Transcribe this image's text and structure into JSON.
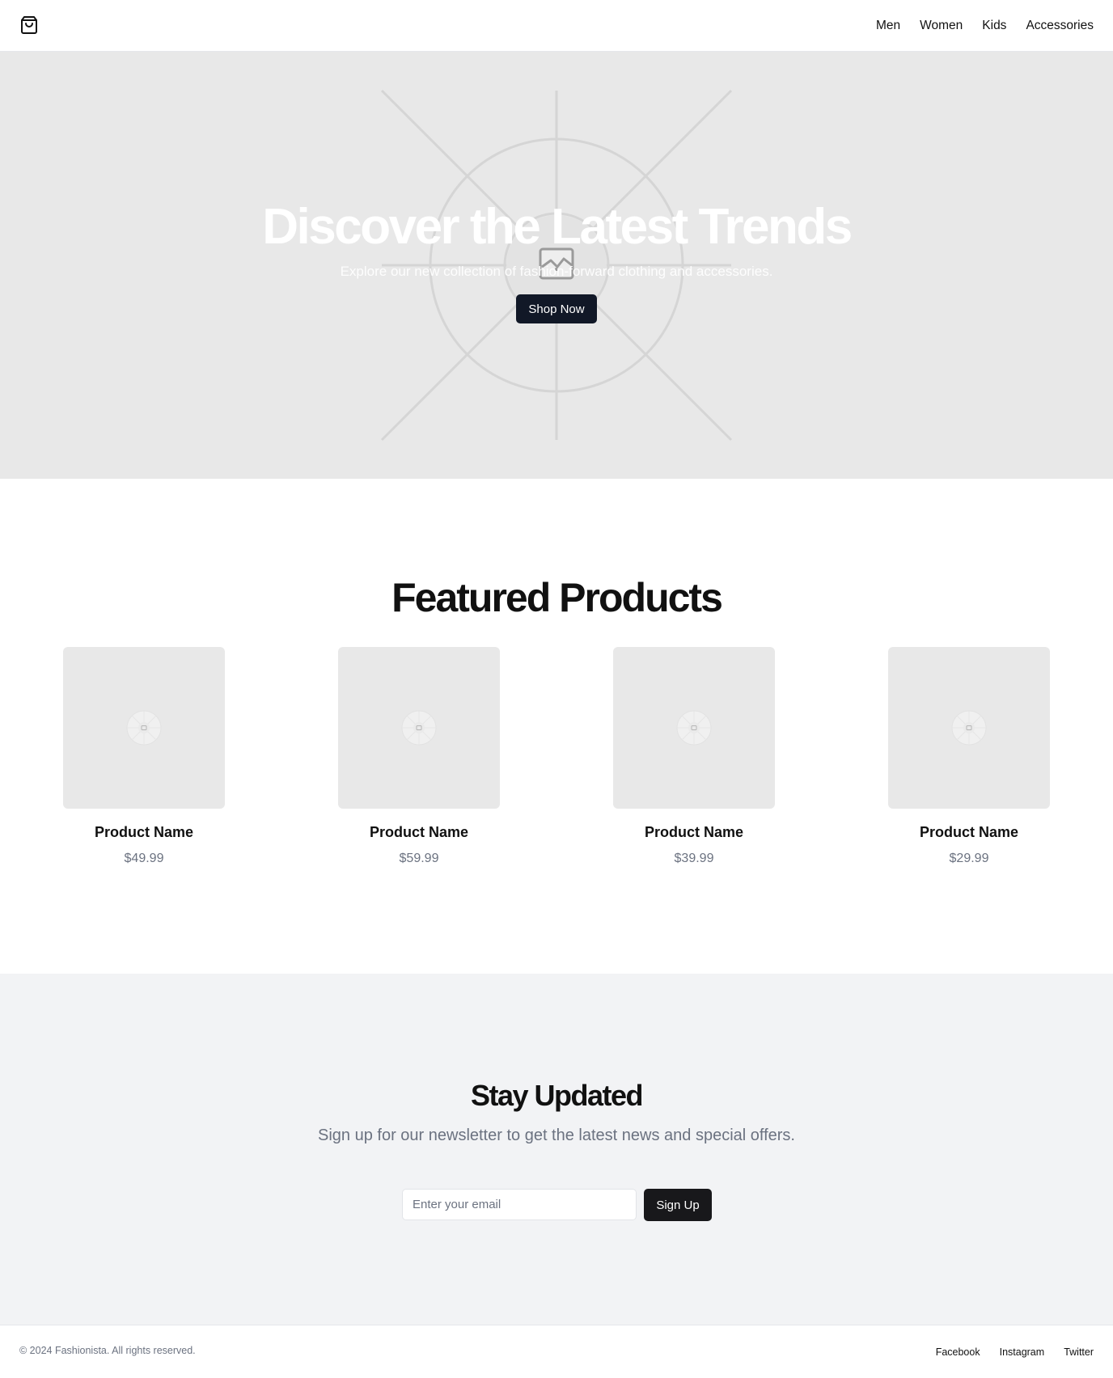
{
  "header": {
    "logo_icon": "shopping-bag-icon",
    "nav": [
      {
        "label": "Men"
      },
      {
        "label": "Women"
      },
      {
        "label": "Kids"
      },
      {
        "label": "Accessories"
      }
    ]
  },
  "hero": {
    "title": "Discover the Latest Trends",
    "subtitle": "Explore our new collection of fashion-forward clothing and accessories.",
    "cta_label": "Shop Now",
    "image_icon": "image-placeholder-icon"
  },
  "featured": {
    "title": "Featured Products",
    "products": [
      {
        "name": "Product Name",
        "price": "$49.99"
      },
      {
        "name": "Product Name",
        "price": "$59.99"
      },
      {
        "name": "Product Name",
        "price": "$39.99"
      },
      {
        "name": "Product Name",
        "price": "$29.99"
      }
    ]
  },
  "newsletter": {
    "title": "Stay Updated",
    "text": "Sign up for our newsletter to get the latest news and special offers.",
    "email_placeholder": "Enter your email",
    "button_label": "Sign Up"
  },
  "footer": {
    "copyright": "© 2024 Fashionista. All rights reserved.",
    "social": [
      {
        "label": "Facebook"
      },
      {
        "label": "Instagram"
      },
      {
        "label": "Twitter"
      }
    ]
  },
  "colors": {
    "primary_button": "#111827",
    "hero_bg": "#e8e8e8",
    "newsletter_bg": "#f2f3f5",
    "muted_text": "#6b7280"
  }
}
